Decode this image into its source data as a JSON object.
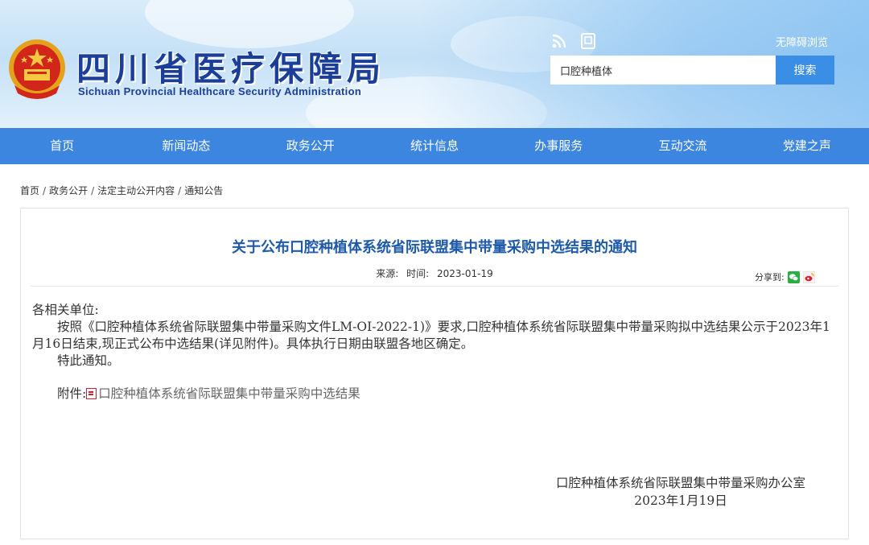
{
  "header": {
    "title": "四川省医疗保障局",
    "subtitle": "Sichuan Provincial Healthcare Security Administration",
    "accessible_link": "无障碍浏览",
    "icons": [
      "rss-icon",
      "mobile-icon"
    ],
    "search": {
      "value": "口腔种植体",
      "button": "搜索"
    },
    "colors": {
      "brand_blue": "#1b3f98",
      "nav_blue": "#3c86e0",
      "search_button": "#3a8ee6"
    }
  },
  "nav": {
    "items": [
      "首页",
      "新闻动态",
      "政务公开",
      "统计信息",
      "办事服务",
      "互动交流",
      "党建之声"
    ]
  },
  "breadcrumb": [
    "首页",
    "政务公开",
    "法定主动公开内容",
    "通知公告"
  ],
  "article": {
    "title": "关于公布口腔种植体系统省际联盟集中带量采购中选结果的通知",
    "source_label": "来源:",
    "time_label": "时间:",
    "time": "2023-01-19",
    "share_label": "分享到:",
    "greeting": "各相关单位:",
    "paragraph1": "按照《口腔种植体系统省际联盟集中带量采购文件LM-OI-2022-1)》要求,口腔种植体系统省际联盟集中带量采购拟中选结果公示于2023年1月16日结束,现正式公布中选结果(详见附件)。具体执行日期由联盟各地区确定。",
    "paragraph2": "特此通知。",
    "attachment_label": "附件:",
    "attachment_link": "口腔种植体系统省际联盟集中带量采购中选结果",
    "signature_org": "口腔种植体系统省际联盟集中带量采购办公室",
    "signature_date": "2023年1月19日"
  }
}
